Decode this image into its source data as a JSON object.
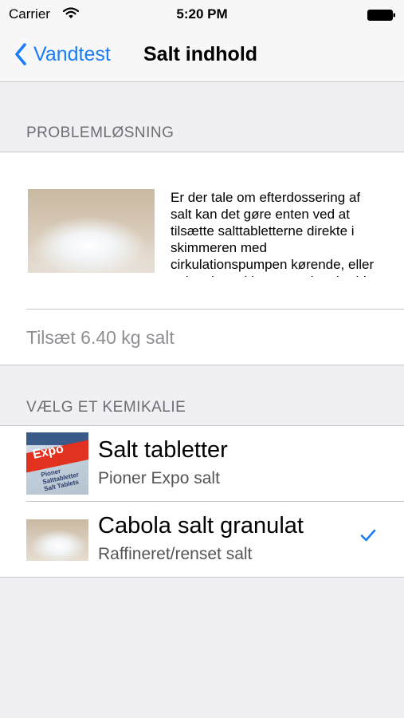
{
  "status_bar": {
    "carrier": "Carrier",
    "time": "5:20 PM"
  },
  "nav": {
    "back_label": "Vandtest",
    "title": "Salt indhold",
    "accent": "#1a7cf6"
  },
  "problem_section": {
    "header": "PROBLEMLØSNING",
    "description": "Er der tale om efterdossering af salt kan det gøre enten ved at tilsætte salttabletterne direkte i skimmeren med cirkulationspumpen kørende, eller opløst i vand i en spand og hælde det i poolen.",
    "add_amount_text": "Tilsæt 6.40 kg salt"
  },
  "chemical_section": {
    "header": "VÆLG ET KEMIKALIE",
    "items": [
      {
        "title": "Salt tabletter",
        "subtitle": "Pioner Expo salt",
        "selected": false
      },
      {
        "title": "Cabola salt granulat",
        "subtitle": "Raffineret/renset salt",
        "selected": true
      }
    ]
  },
  "package_label": {
    "brand": "Expo",
    "line1": "Pioner",
    "line2": "Salttabletter",
    "line3": "Salt Tablets"
  }
}
